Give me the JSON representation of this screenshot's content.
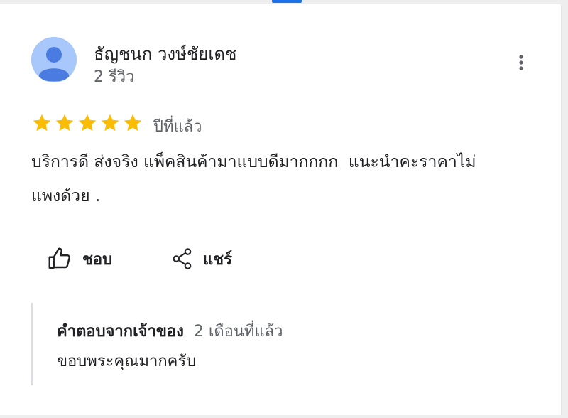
{
  "reviewer": {
    "name": "ธัญชนก วงษ์ชัยเดช",
    "review_count": "2 รีวิว",
    "avatar_icon": "person-avatar-icon",
    "avatar_bg": "#a8c7fa",
    "avatar_fg": "#4a7be0"
  },
  "menu_icon": "more-vert-icon",
  "rating": {
    "stars": 5,
    "max_stars": 5,
    "star_color": "#fbbc04",
    "time": "ปีที่แล้ว"
  },
  "review": {
    "text": "บริการดี ส่งจริง แพ็คสินค้ามาแบบดีมากกกก  แนะนำคะราคาไม่\nแพงด้วย ."
  },
  "actions": {
    "like_label": "ชอบ",
    "like_icon": "thumbs-up-icon",
    "share_label": "แชร์",
    "share_icon": "share-icon"
  },
  "owner_reply": {
    "title": "คำตอบจากเจ้าของ",
    "time": "2 เดือนที่แล้ว",
    "text": "ขอบพระคุณมากครับ"
  }
}
